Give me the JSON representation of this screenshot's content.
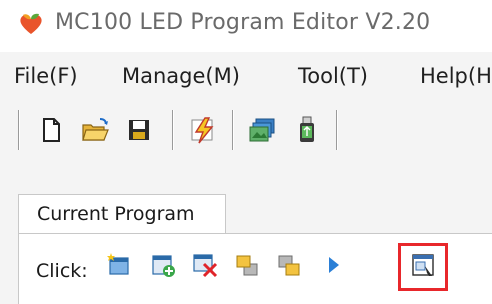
{
  "window": {
    "title": "MC100 LED Program Editor V2.20",
    "app_icon": "heart-leaf-logo-icon"
  },
  "menu": {
    "items": [
      {
        "label": "File(F)"
      },
      {
        "label": "Manage(M)"
      },
      {
        "label": "Tool(T)"
      },
      {
        "label": "Help(H"
      }
    ]
  },
  "toolbar": {
    "buttons": [
      {
        "icon": "new-file-icon"
      },
      {
        "icon": "open-folder-icon"
      },
      {
        "icon": "save-icon"
      },
      {
        "icon": "send-lightning-icon"
      },
      {
        "icon": "screen-preview-icon"
      },
      {
        "icon": "usb-drive-icon"
      }
    ]
  },
  "program_panel": {
    "tab_label": "Current Program",
    "click_label": "Click:",
    "actions": [
      {
        "icon": "new-program-icon"
      },
      {
        "icon": "add-area-icon"
      },
      {
        "icon": "delete-area-icon"
      },
      {
        "icon": "move-up-icon"
      },
      {
        "icon": "move-down-icon"
      },
      {
        "icon": "play-preview-icon"
      },
      {
        "icon": "properties-window-icon"
      }
    ],
    "highlighted_action": "properties-window-icon",
    "highlight_color": "#e8272b"
  }
}
